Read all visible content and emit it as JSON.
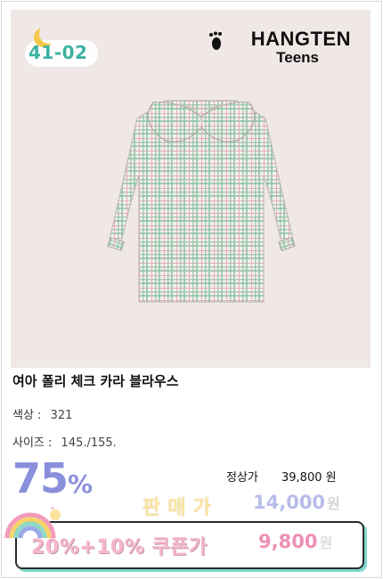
{
  "badge": {
    "code": "41-02"
  },
  "brand": {
    "name": "HANGTEN",
    "sub": "Teens"
  },
  "product": {
    "title": "여아 폴리 체크 카라 블라우스",
    "color_label": "색상 :",
    "color_value": "321",
    "size_label": "사이즈 :",
    "size_value": "145./155."
  },
  "pricing": {
    "discount_number": "75",
    "discount_symbol": "%",
    "regular_label": "정상가",
    "regular_price": "39,800 원",
    "sale_label": "판매가",
    "sale_price": "14,000",
    "sale_unit": "원",
    "coupon_label": "20%+10% 쿠폰가",
    "coupon_price": "9,800",
    "coupon_unit": "원"
  },
  "colors": {
    "accent_purple": "#8a8fdc",
    "badge_teal": "#3db3a2",
    "coupon_pink": "#ee8fb6",
    "photo_bg": "#efe8e6"
  }
}
